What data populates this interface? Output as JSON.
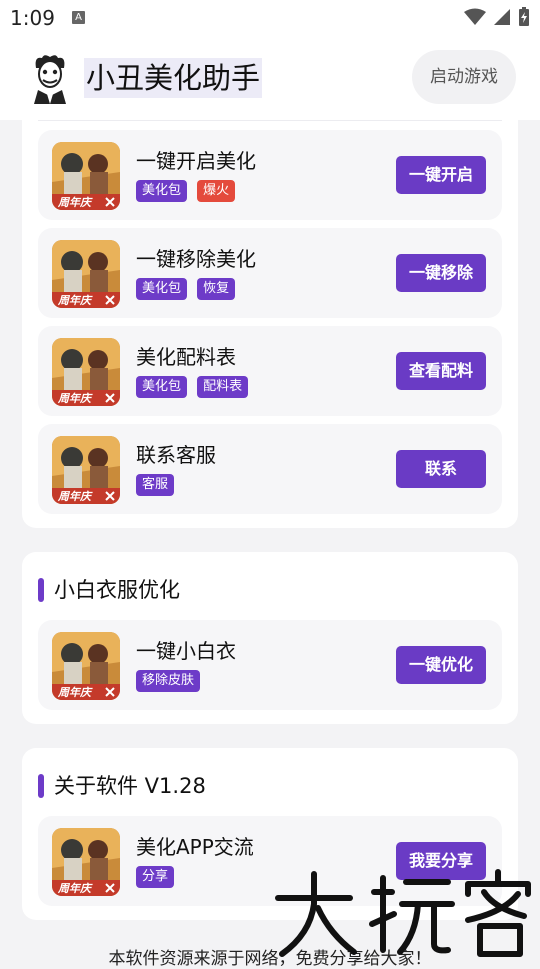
{
  "status_bar": {
    "time": "1:09",
    "notification_icon": "a-badge-icon",
    "indicators": [
      "wifi-icon",
      "signal-icon",
      "battery-charging-icon"
    ]
  },
  "header": {
    "title": "小丑美化助手",
    "launch_button": "启动游戏",
    "avatar_icon": "joker-avatar-icon"
  },
  "section_main": {
    "items": [
      {
        "title": "一键开启美化",
        "tags": [
          {
            "text": "美化包",
            "type": "normal"
          },
          {
            "text": "爆火",
            "type": "hot"
          }
        ],
        "button": "一键开启"
      },
      {
        "title": "一键移除美化",
        "tags": [
          {
            "text": "美化包",
            "type": "normal"
          },
          {
            "text": "恢复",
            "type": "normal"
          }
        ],
        "button": "一键移除"
      },
      {
        "title": "美化配料表",
        "tags": [
          {
            "text": "美化包",
            "type": "normal"
          },
          {
            "text": "配料表",
            "type": "normal"
          }
        ],
        "button": "查看配料"
      },
      {
        "title": "联系客服",
        "tags": [
          {
            "text": "客服",
            "type": "normal"
          }
        ],
        "button": "联系"
      }
    ]
  },
  "section_white": {
    "title": "小白衣服优化",
    "items": [
      {
        "title": "一键小白衣",
        "tags": [
          {
            "text": "移除皮肤",
            "type": "normal"
          }
        ],
        "button": "一键优化"
      }
    ]
  },
  "section_about": {
    "title": "关于软件 V1.28",
    "items": [
      {
        "title": "美化APP交流",
        "tags": [
          {
            "text": "分享",
            "type": "normal"
          }
        ],
        "button": "我要分享"
      }
    ]
  },
  "thumbnail": {
    "badge_text": "周年庆",
    "icon": "game-thumbnail-icon"
  },
  "footer": {
    "text": "本软件资源来源于网络，免费分享给大家！"
  },
  "watermark": {
    "text": "大玩客"
  },
  "colors": {
    "accent": "#6a3bc5",
    "hot": "#e44a3c",
    "card_bg": "#ffffff",
    "item_bg": "#f6f6f8",
    "page_bg": "#f3f3f5"
  }
}
